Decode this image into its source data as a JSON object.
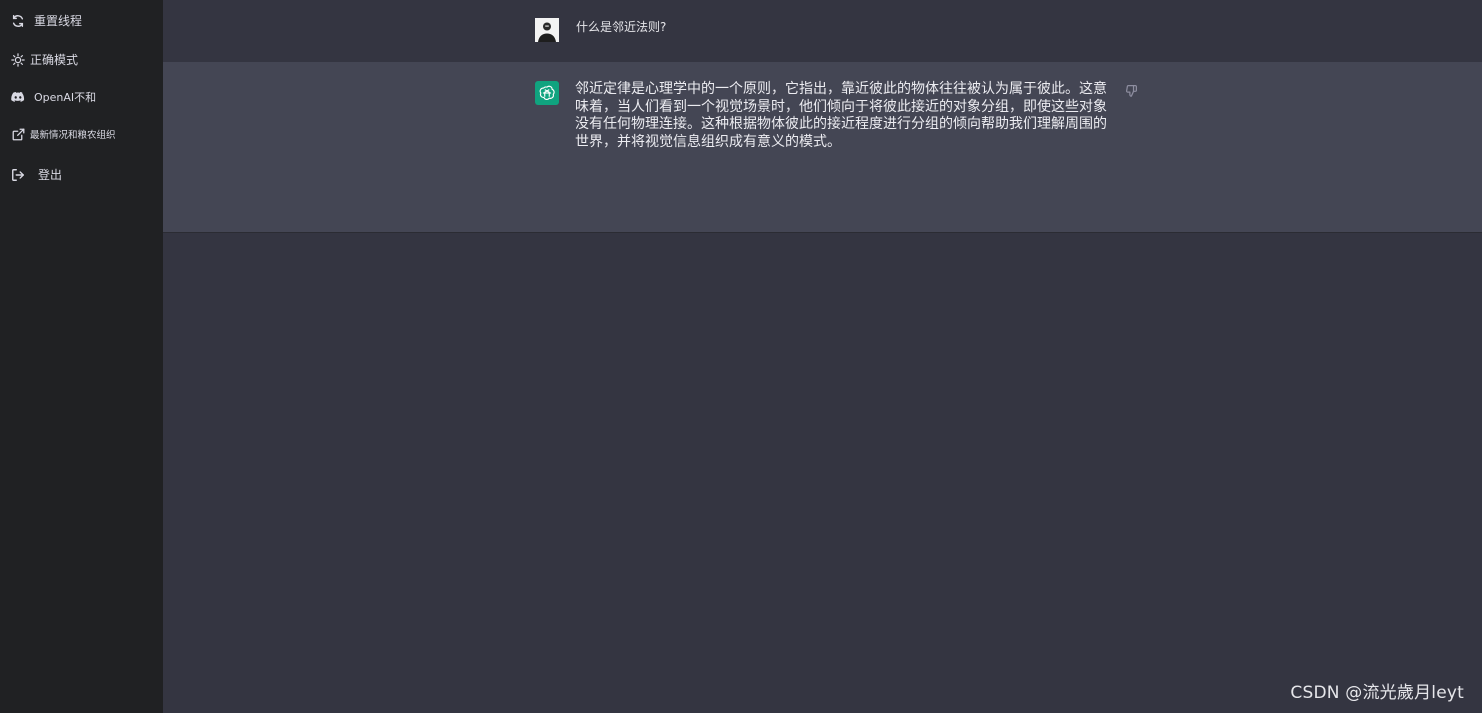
{
  "sidebar": {
    "items": [
      {
        "label": "重置线程",
        "icon": "refresh-icon"
      },
      {
        "label": "正确模式",
        "icon": "sun-icon"
      },
      {
        "label": "OpenAI不和",
        "icon": "discord-icon"
      },
      {
        "label": "最新情况和粮农组织",
        "icon": "external-link-icon"
      },
      {
        "label": "登出",
        "icon": "logout-icon"
      }
    ]
  },
  "conversation": {
    "user_message": "什么是邻近法则?",
    "assistant_message": "邻近定律是心理学中的一个原则，它指出，靠近彼此的物体往往被认为属于彼此。这意味着，当人们看到一个视觉场景时，他们倾向于将彼此接近的对象分组，即使这些对象没有任何物理连接。这种根据物体彼此的接近程度进行分组的倾向帮助我们理解周围的世界，并将视觉信息组织成有意义的模式。"
  },
  "watermark": "CSDN @流光歲月leyt",
  "colors": {
    "sidebar_bg": "#202123",
    "main_bg": "#343541",
    "assistant_row_bg": "#444654",
    "assistant_avatar": "#10a37f"
  }
}
